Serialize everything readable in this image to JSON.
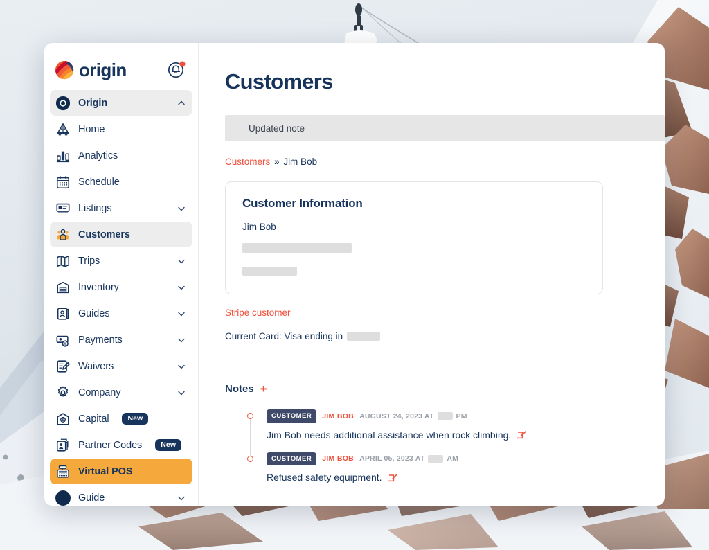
{
  "brand": {
    "word": "origin",
    "logo_icon": "origin-swirl-logo",
    "bell_icon": "notification-bell-icon",
    "colors": {
      "navy": "#17345c",
      "orange": "#f5a93d",
      "red": "#f1503c",
      "badge_slate": "#3f4a6b"
    }
  },
  "sidebar": {
    "items": [
      {
        "label": "Origin",
        "icon": "origin-circle-icon",
        "state": "header",
        "chevron": "up",
        "badge": null
      },
      {
        "label": "Home",
        "icon": "home-mountain-icon",
        "state": "normal",
        "chevron": null,
        "badge": null
      },
      {
        "label": "Analytics",
        "icon": "bar-chart-icon",
        "state": "normal",
        "chevron": null,
        "badge": null
      },
      {
        "label": "Schedule",
        "icon": "calendar-icon",
        "state": "normal",
        "chevron": null,
        "badge": null
      },
      {
        "label": "Listings",
        "icon": "listing-card-icon",
        "state": "normal",
        "chevron": "down",
        "badge": null
      },
      {
        "label": "Customers",
        "icon": "people-group-icon",
        "state": "active",
        "chevron": null,
        "badge": null
      },
      {
        "label": "Trips",
        "icon": "map-fold-icon",
        "state": "normal",
        "chevron": "down",
        "badge": null
      },
      {
        "label": "Inventory",
        "icon": "warehouse-icon",
        "state": "normal",
        "chevron": "down",
        "badge": null
      },
      {
        "label": "Guides",
        "icon": "id-card-person-icon",
        "state": "normal",
        "chevron": "down",
        "badge": null
      },
      {
        "label": "Payments",
        "icon": "money-bill-icon",
        "state": "normal",
        "chevron": "down",
        "badge": null
      },
      {
        "label": "Waivers",
        "icon": "document-pen-icon",
        "state": "normal",
        "chevron": "down",
        "badge": null
      },
      {
        "label": "Company",
        "icon": "gear-icon",
        "state": "normal",
        "chevron": "down",
        "badge": null
      },
      {
        "label": "Capital",
        "icon": "bank-dollar-icon",
        "state": "normal",
        "chevron": null,
        "badge": "New"
      },
      {
        "label": "Partner Codes",
        "icon": "cards-person-icon",
        "state": "normal",
        "chevron": null,
        "badge": "New"
      },
      {
        "label": "Virtual POS",
        "icon": "cash-register-icon",
        "state": "selected",
        "chevron": null,
        "badge": null
      },
      {
        "label": "Guide",
        "icon": "user-avatar-icon",
        "state": "normal",
        "chevron": "down",
        "badge": null
      }
    ]
  },
  "main": {
    "page_title": "Customers",
    "alert": {
      "text": "Updated note"
    },
    "breadcrumb": {
      "root": "Customers",
      "separator": "»",
      "current": "Jim Bob"
    },
    "customer_card": {
      "heading": "Customer Information",
      "name": "Jim Bob",
      "redacted_email_width": 158,
      "redacted_phone_width": 79
    },
    "stripe_link": "Stripe customer",
    "card_line": {
      "label": "Current Card: Visa ending in",
      "redacted_digits_width": 48
    },
    "notes": {
      "title": "Notes",
      "add_label": "+",
      "items": [
        {
          "tag": "CUSTOMER",
          "author": "JIM BOB",
          "date_prefix": "AUGUST 24, 2023 AT",
          "date_suffix": "PM",
          "body": "Jim Bob needs additional assistance when rock climbing.",
          "edit_icon": "edit-pencil-icon"
        },
        {
          "tag": "CUSTOMER",
          "author": "JIM BOB",
          "date_prefix": "APRIL 05, 2023 AT",
          "date_suffix": "AM",
          "body": "Refused safety equipment.",
          "edit_icon": "edit-pencil-icon"
        }
      ]
    }
  }
}
